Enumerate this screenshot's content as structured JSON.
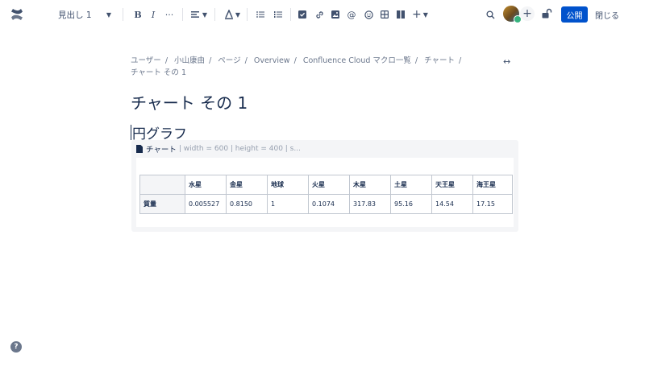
{
  "toolbar": {
    "text_style": "見出し 1",
    "more_label": "···",
    "publish_label": "公開",
    "close_label": "閉じる"
  },
  "breadcrumb": [
    "ユーザー",
    "小山康由",
    "ページ",
    "Overview",
    "Confluence Cloud マクロ一覧",
    "チャート",
    "チャート その 1"
  ],
  "page": {
    "title": "チャート その 1",
    "heading": "円グラフ"
  },
  "macro": {
    "name": "チャート",
    "params": "| width = 600 | height = 400 | s..."
  },
  "table": {
    "headers": [
      "",
      "水星",
      "金星",
      "地球",
      "火星",
      "木星",
      "土星",
      "天王星",
      "海王星"
    ],
    "rows": [
      [
        "質量",
        "0.005527",
        "0.8150",
        "1",
        "0.1074",
        "317.83",
        "95.16",
        "14.54",
        "17.15"
      ]
    ]
  },
  "colors": {
    "primary": "#0052cc",
    "text": "#172b4d",
    "subtle": "#6b778c"
  }
}
